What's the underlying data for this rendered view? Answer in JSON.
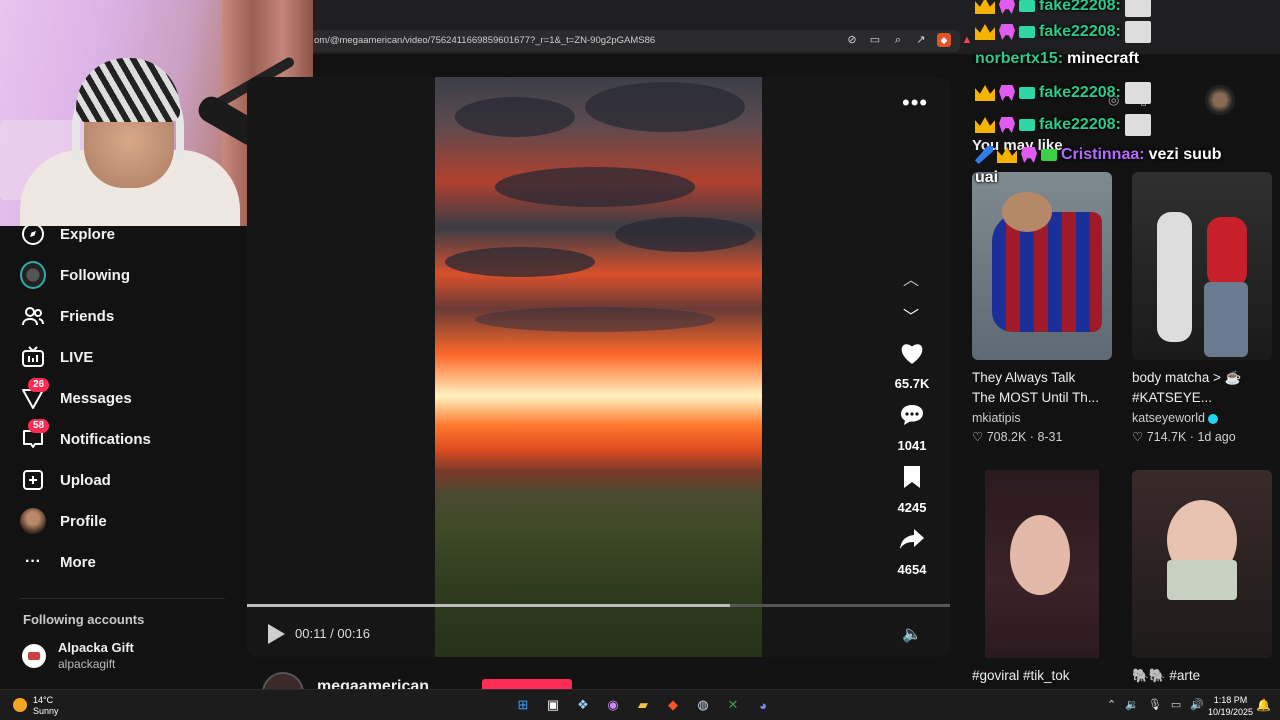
{
  "browser": {
    "url": "om/@megaamerican/video/7562411669859601677?_r=1&_t=ZN-90g2pGAMS86"
  },
  "sidebar": {
    "items": [
      {
        "label": "Explore"
      },
      {
        "label": "Following"
      },
      {
        "label": "Friends"
      },
      {
        "label": "LIVE"
      },
      {
        "label": "Messages",
        "badge": "26"
      },
      {
        "label": "Notifications",
        "badge": "58"
      },
      {
        "label": "Upload"
      },
      {
        "label": "Profile"
      },
      {
        "label": "More"
      }
    ],
    "following_title": "Following accounts",
    "accounts": [
      {
        "name": "Alpacka Gift",
        "handle": "alpackagift"
      }
    ]
  },
  "video": {
    "time": "00:11 / 00:16",
    "progress": 0.6875,
    "likes": "65.7K",
    "comments": "1041",
    "saves": "4245",
    "shares": "4654",
    "author": "megaamerican"
  },
  "right": {
    "heading": "You may like",
    "cards": [
      {
        "title": "They Always Talk",
        "title2": "The MOST Until Th...",
        "author": "mkiatipis",
        "likes": "708.2K",
        "date": "8-31"
      },
      {
        "title": "body matcha > ☕",
        "title2": "#KATSEYE...",
        "author": "katseyeworld",
        "likes": "714.7K",
        "date": "1d ago"
      },
      {
        "title": "#goviral #tik_tok",
        "title2": "",
        "author": "",
        "likes": "",
        "date": ""
      },
      {
        "title": "🐘🐘 #arte",
        "title2": "",
        "author": "",
        "likes": "",
        "date": ""
      }
    ]
  },
  "chat": [
    {
      "user": "fake22208:",
      "msg": ""
    },
    {
      "user": "fake22208:",
      "msg": ""
    },
    {
      "user": "norbertx15:",
      "msg": "minecraft"
    },
    {
      "user": "fake22208:",
      "msg": ""
    },
    {
      "user": "fake22208:",
      "msg": ""
    },
    {
      "user": "Cristinnaa:",
      "msg": "vezi suub"
    },
    {
      "user": "",
      "msg": "uai"
    }
  ],
  "taskbar": {
    "temp": "14°C",
    "weather": "Sunny",
    "time": "1:18 PM",
    "date": "10/19/2025"
  }
}
